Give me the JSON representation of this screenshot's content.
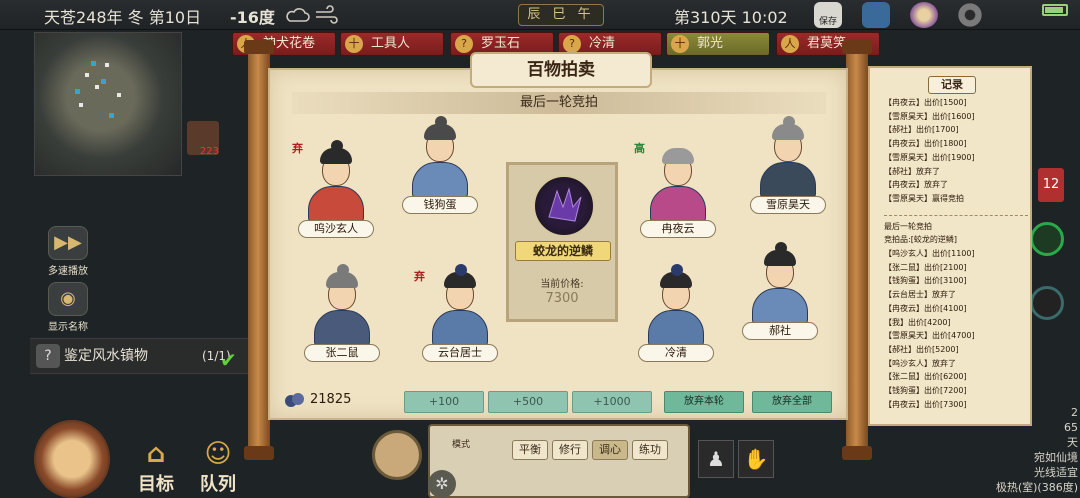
{
  "topbar": {
    "date": "天苍248年 冬 第10日",
    "temperature": "-16度",
    "shichen": "辰 巳 午",
    "day_time": "第310天 10:02",
    "save_label": "保存"
  },
  "tags": [
    {
      "label": "神犬花卷",
      "badge": "人",
      "style": "red"
    },
    {
      "label": "工具人",
      "badge": "十",
      "style": "red"
    },
    {
      "label": "罗玉石",
      "badge": "?",
      "style": "red"
    },
    {
      "label": "冷清",
      "badge": "?",
      "style": "red"
    },
    {
      "label": "郭光",
      "badge": "十",
      "style": "green"
    },
    {
      "label": "君莫笑",
      "badge": "人",
      "style": "red"
    }
  ],
  "map_item_count": "223",
  "side_buttons": {
    "speed": "多速播放",
    "show_names": "显示名称"
  },
  "task": {
    "label": "鉴定风水镇物",
    "progress": "(1/1)"
  },
  "bottom_nav": {
    "target": "目标",
    "team": "队列"
  },
  "bottom_panel": {
    "label": "模式",
    "buttons": [
      "平衡",
      "修行",
      "调心",
      "练功"
    ]
  },
  "right_status": {
    "lines": [
      "2",
      "65",
      "天",
      "宛如仙境",
      "光线适宜",
      "极热(室)(386度)"
    ],
    "badge": "12"
  },
  "auction": {
    "title": "百物拍卖",
    "subtitle": "最后一轮竞拍",
    "item_name": "蛟龙的逆鳞",
    "price_label": "当前价格:",
    "price": "7300",
    "coins": "21825",
    "bid_buttons": [
      "+100",
      "+500",
      "+1000"
    ],
    "action_buttons": [
      "放弃本轮",
      "放弃全部"
    ],
    "mark_abandon": "弃",
    "mark_high": "高",
    "bidders": [
      {
        "name": "呜沙玄人"
      },
      {
        "name": "钱狗蛋"
      },
      {
        "name": "冉夜云"
      },
      {
        "name": "雪原昊天"
      },
      {
        "name": "张二鼠"
      },
      {
        "name": "云台居士"
      },
      {
        "name": "冷清"
      },
      {
        "name": "郝社"
      }
    ]
  },
  "log": {
    "title": "记录",
    "entries": [
      "【冉夜云】出价[1500]",
      "【雪原昊天】出价[1600]",
      "【郝社】出价[1700]",
      "【冉夜云】出价[1800]",
      "【雪原昊天】出价[1900]",
      "【郝社】放弃了",
      "【冉夜云】放弃了",
      "【雪原昊天】赢得竞拍"
    ],
    "entries2": [
      "最后一轮竞拍",
      "竞拍品:[蛟龙的逆鳞]",
      "【呜沙玄人】出价[1100]",
      "【张二鼠】出价[2100]",
      "【钱狗蛋】出价[3100]",
      "【云台居士】放弃了",
      "【冉夜云】出价[4100]",
      "【我】出价[4200]",
      "【雪原昊天】出价[4700]",
      "【郝社】出价[5200]",
      "【呜沙玄人】放弃了",
      "【张二鼠】出价[6200]",
      "【钱狗蛋】出价[7200]",
      "【冉夜云】出价[7300]"
    ]
  },
  "colors": {
    "scroll_paper": "#efe3c4",
    "tag_red": "#9a2a2a",
    "bid_button": "#8fc4b0",
    "abandon_mark": "#b02020",
    "high_mark": "#2a8a3a"
  }
}
